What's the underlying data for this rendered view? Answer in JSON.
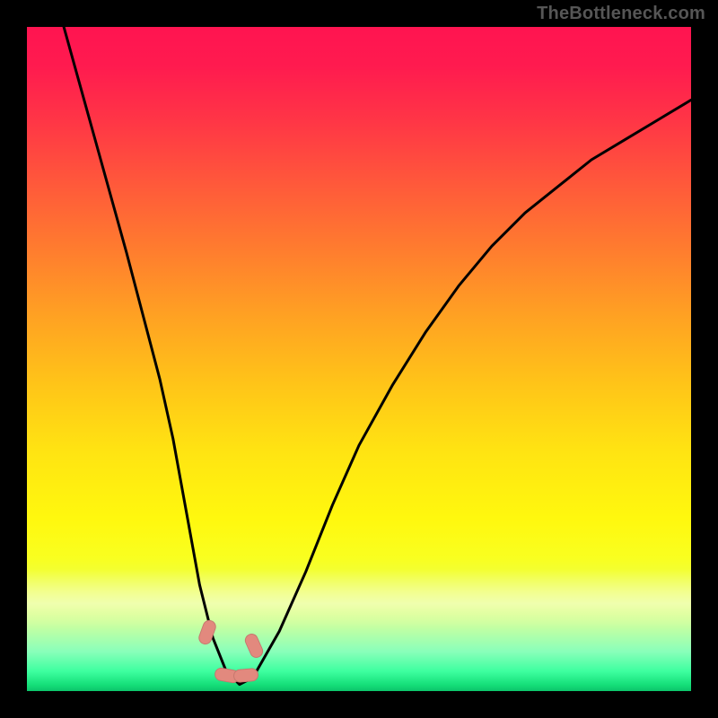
{
  "watermark": "TheBottleneck.com",
  "chart_data": {
    "type": "line",
    "title": "",
    "xlabel": "",
    "ylabel": "",
    "xlim": [
      0,
      100
    ],
    "ylim": [
      0,
      100
    ],
    "grid": false,
    "legend": false,
    "series": [
      {
        "name": "bottleneck-curve",
        "x": [
          0,
          5,
          10,
          15,
          20,
          22,
          24,
          26,
          28,
          30,
          32,
          34,
          38,
          42,
          46,
          50,
          55,
          60,
          65,
          70,
          75,
          80,
          85,
          90,
          95,
          100
        ],
        "values": [
          120,
          102,
          84,
          66,
          47,
          38,
          27,
          16,
          8,
          3,
          1,
          2,
          9,
          18,
          28,
          37,
          46,
          54,
          61,
          67,
          72,
          76,
          80,
          83,
          86,
          89
        ]
      }
    ],
    "markers": [
      {
        "name": "left-segment-marker",
        "x": 27,
        "y": 9,
        "angle_deg": -70
      },
      {
        "name": "right-segment-marker",
        "x": 34,
        "y": 7,
        "angle_deg": 66
      },
      {
        "name": "minimum-marker-left",
        "x": 30,
        "y": 2.5,
        "angle_deg": 10
      },
      {
        "name": "minimum-marker-right",
        "x": 32.8,
        "y": 2.5,
        "angle_deg": -5
      }
    ],
    "colors": {
      "curve": "#000000",
      "marker": "#e2897e",
      "gradient_top": "#ff1450",
      "gradient_mid": "#ffe412",
      "gradient_bottom": "#0cc56a",
      "background": "#000000"
    }
  }
}
